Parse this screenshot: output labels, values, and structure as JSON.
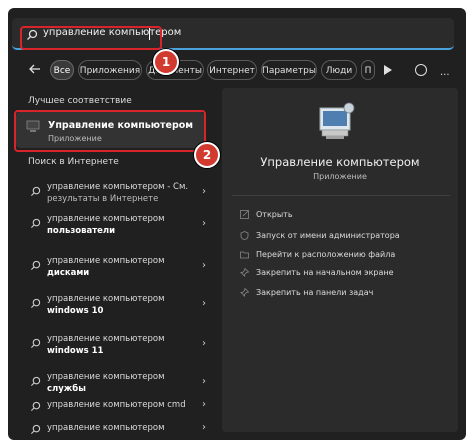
{
  "search": {
    "query": "управление компьютером"
  },
  "tabs": [
    "Все",
    "Приложения",
    "Документы",
    "Интернет",
    "Параметры",
    "Люди",
    "П"
  ],
  "sections": {
    "best_match": "Лучшее соответствие",
    "web_search": "Поиск в Интернете"
  },
  "best": {
    "title": "Управление компьютером",
    "subtitle": "Приложение"
  },
  "results": [
    {
      "line1": "управление компьютером - См.",
      "line2": "результаты в Интернете",
      "bold": false
    },
    {
      "line1": "управление компьютером",
      "line2": "пользователи",
      "bold": true
    },
    {
      "line1": "управление компьютером",
      "line2": "дисками",
      "bold": true
    },
    {
      "line1": "управление компьютером",
      "line2": "windows 10",
      "bold": true
    },
    {
      "line1": "управление компьютером",
      "line2": "windows 11",
      "bold": true
    },
    {
      "line1": "управление компьютером",
      "line2": "службы",
      "bold": true
    },
    {
      "line1": "управление компьютером cmd",
      "line2": "",
      "bold": false
    },
    {
      "line1": "управление компьютером",
      "line2": "",
      "bold": false
    }
  ],
  "detail": {
    "title": "Управление компьютером",
    "subtitle": "Приложение",
    "actions": [
      {
        "label": "Открыть",
        "icon": "open-icon"
      },
      {
        "label": "Запуск от имени администратора",
        "icon": "admin-shield-icon"
      },
      {
        "label": "Перейти к расположению файла",
        "icon": "folder-icon"
      },
      {
        "label": "Закрепить на начальном экране",
        "icon": "pin-icon"
      },
      {
        "label": "Закрепить на панели задач",
        "icon": "pin-icon"
      }
    ]
  },
  "badges": [
    "1",
    "2"
  ],
  "colors": {
    "highlight": "#d9242b",
    "badge": "#d23a30",
    "accent": "#4aa3df"
  }
}
